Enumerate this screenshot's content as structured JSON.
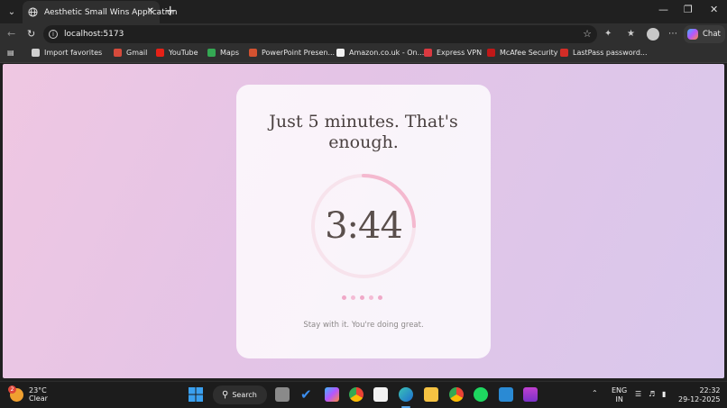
{
  "browser": {
    "tab_title": "Aesthetic Small Wins Application",
    "url": "localhost:5173",
    "copilot_label": "Chat",
    "favorites": [
      {
        "label": "Import favorites",
        "color": "#cfcfcf"
      },
      {
        "label": "Gmail",
        "color": "#d64a3b"
      },
      {
        "label": "YouTube",
        "color": "#e62117"
      },
      {
        "label": "Maps",
        "color": "#34a853"
      },
      {
        "label": "PowerPoint Presen...",
        "color": "#d35230"
      },
      {
        "label": "Amazon.co.uk - On...",
        "color": "#f2f2f2"
      },
      {
        "label": "Express VPN",
        "color": "#da3940"
      },
      {
        "label": "McAfee Security",
        "color": "#c01818"
      },
      {
        "label": "LastPass password...",
        "color": "#d32d27"
      }
    ]
  },
  "app": {
    "heading": "Just 5 minutes. That's enough.",
    "timer": "3:44",
    "progress_fraction": 0.25,
    "dots_count": 5,
    "message": "Stay with it. You're doing great.",
    "accent_color": "#f0a9c8"
  },
  "taskbar": {
    "weather_temp": "23°C",
    "weather_desc": "Clear",
    "weather_badge": "2",
    "search_label": "Search",
    "lang_top": "ENG",
    "lang_bottom": "IN",
    "time": "22:32",
    "date": "29-12-2025"
  }
}
